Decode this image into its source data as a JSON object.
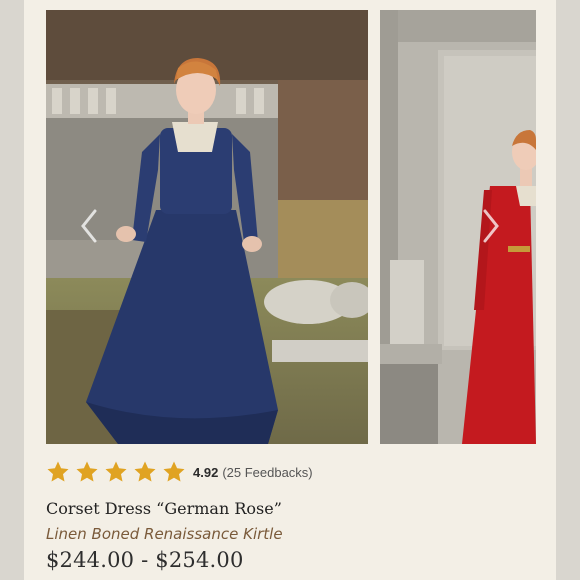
{
  "product": {
    "rating": {
      "stars": 5,
      "value": "4.92",
      "count_text": "(25 Feedbacks)",
      "star_color": "#e0a322"
    },
    "title": "Corset Dress “German Rose”",
    "subtitle": "Linen Boned Renaissance Kirtle",
    "price": "$244.00 - $254.00"
  },
  "gallery": {
    "main_image": {
      "dress_color": "#27386a"
    },
    "next_image": {
      "dress_color": "#c41a1f"
    },
    "prev_icon": "chevron-left-icon",
    "next_icon": "chevron-right-icon"
  }
}
